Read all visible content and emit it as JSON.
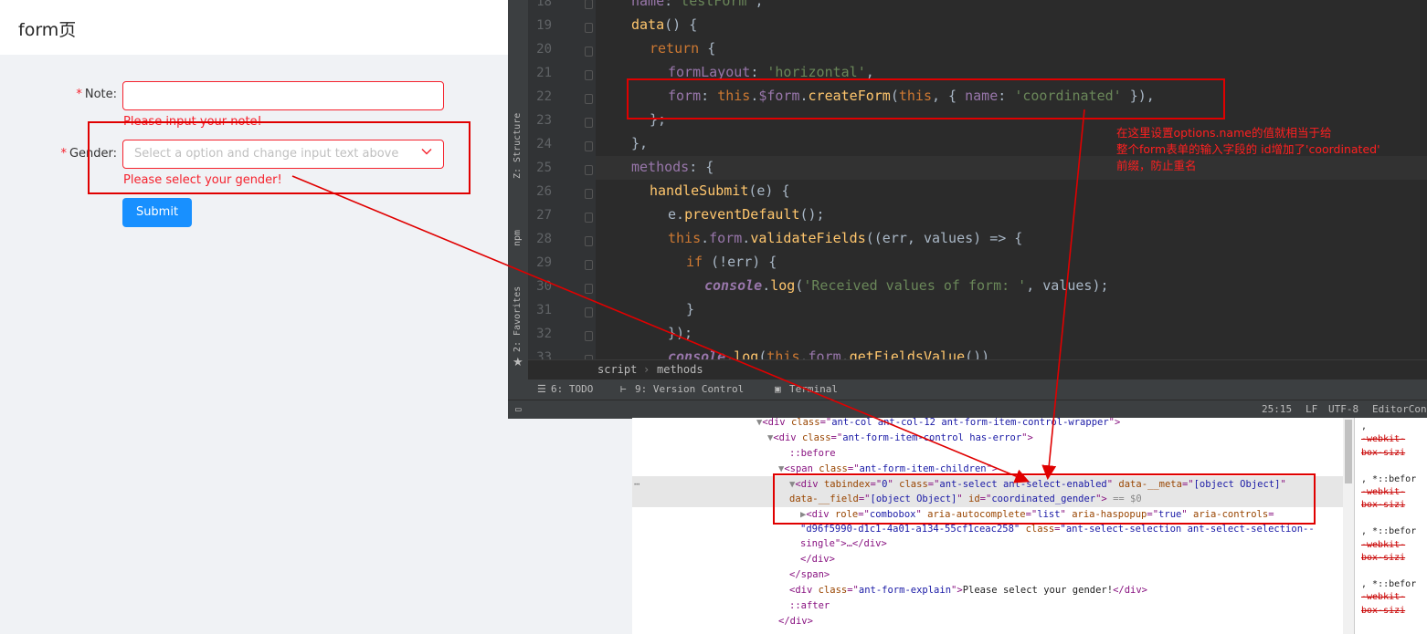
{
  "form_page": {
    "title": "form页",
    "note_label": "Note:",
    "note_value": "",
    "note_error": "Please input your note!",
    "gender_label": "Gender:",
    "gender_placeholder": "Select a option and change input text above",
    "gender_error": "Please select your gender!",
    "required_mark": "*",
    "submit_label": "Submit"
  },
  "ide": {
    "lines": [
      {
        "n": "18",
        "indent": 1,
        "tokens": [
          [
            "prop",
            "name"
          ],
          [
            "plain",
            ":"
          ],
          [
            "str",
            "'testForm'"
          ],
          [
            "plain",
            ","
          ]
        ]
      },
      {
        "n": "19",
        "indent": 1,
        "tokens": [
          [
            "fn",
            "data"
          ],
          [
            "plain",
            "() {"
          ]
        ]
      },
      {
        "n": "20",
        "indent": 2,
        "tokens": [
          [
            "kw",
            "return"
          ],
          [
            "plain",
            " {"
          ]
        ]
      },
      {
        "n": "21",
        "indent": 3,
        "tokens": [
          [
            "prop",
            "formLayout"
          ],
          [
            "plain",
            ": "
          ],
          [
            "str",
            "'horizontal'"
          ],
          [
            "plain",
            ","
          ]
        ]
      },
      {
        "n": "22",
        "indent": 3,
        "tokens": [
          [
            "prop",
            "form"
          ],
          [
            "plain",
            ": "
          ],
          [
            "kw",
            "this"
          ],
          [
            "plain",
            "."
          ],
          [
            "prop",
            "$form"
          ],
          [
            "plain",
            "."
          ],
          [
            "fn",
            "createForm"
          ],
          [
            "plain",
            "("
          ],
          [
            "kw",
            "this"
          ],
          [
            "plain",
            ", { "
          ],
          [
            "prop",
            "name"
          ],
          [
            "plain",
            ": "
          ],
          [
            "str",
            "'coordinated'"
          ],
          [
            "plain",
            " }),"
          ]
        ]
      },
      {
        "n": "23",
        "indent": 2,
        "tokens": [
          [
            "plain",
            "};"
          ]
        ]
      },
      {
        "n": "24",
        "indent": 1,
        "tokens": [
          [
            "plain",
            "},"
          ]
        ]
      },
      {
        "n": "25",
        "indent": 1,
        "tokens": [
          [
            "prop",
            "methods"
          ],
          [
            "plain",
            ": {"
          ]
        ]
      },
      {
        "n": "26",
        "indent": 2,
        "tokens": [
          [
            "fn",
            "handleSubmit"
          ],
          [
            "plain",
            "(e) {"
          ]
        ]
      },
      {
        "n": "27",
        "indent": 3,
        "tokens": [
          [
            "plain",
            "e."
          ],
          [
            "fn",
            "preventDefault"
          ],
          [
            "plain",
            "();"
          ]
        ]
      },
      {
        "n": "28",
        "indent": 3,
        "tokens": [
          [
            "kw",
            "this"
          ],
          [
            "plain",
            "."
          ],
          [
            "prop",
            "form"
          ],
          [
            "plain",
            "."
          ],
          [
            "fn",
            "validateFields"
          ],
          [
            "plain",
            "((err, values) => {"
          ]
        ]
      },
      {
        "n": "29",
        "indent": 4,
        "tokens": [
          [
            "kw",
            "if"
          ],
          [
            "plain",
            " (!err) {"
          ]
        ]
      },
      {
        "n": "30",
        "indent": 5,
        "tokens": [
          [
            "cons",
            "console"
          ],
          [
            "plain",
            "."
          ],
          [
            "fn",
            "log"
          ],
          [
            "plain",
            "("
          ],
          [
            "str",
            "'Received values of form: '"
          ],
          [
            "plain",
            ", values);"
          ]
        ]
      },
      {
        "n": "31",
        "indent": 4,
        "tokens": [
          [
            "plain",
            "}"
          ]
        ]
      },
      {
        "n": "32",
        "indent": 3,
        "tokens": [
          [
            "plain",
            "});"
          ]
        ]
      },
      {
        "n": "33",
        "indent": 3,
        "tokens": [
          [
            "cons",
            "console"
          ],
          [
            "plain",
            "."
          ],
          [
            "fn",
            "log"
          ],
          [
            "plain",
            "("
          ],
          [
            "kw",
            "this"
          ],
          [
            "plain",
            "."
          ],
          [
            "prop",
            "form"
          ],
          [
            "plain",
            "."
          ],
          [
            "fn",
            "getFieldsValue"
          ],
          [
            "plain",
            "())"
          ]
        ]
      }
    ],
    "sidebar_structure": "Z: Structure",
    "sidebar_npm": "npm",
    "sidebar_favorites": "2: Favorites",
    "breadcrumb": [
      "script",
      "methods"
    ],
    "tool_todo": "6: TODO",
    "tool_vcs": "9: Version Control",
    "tool_terminal": "Terminal",
    "status_pos": "25:15",
    "status_lf": "LF",
    "status_enc": "UTF-8",
    "status_editor": "EditorCon"
  },
  "annotation": {
    "line1": "在这里设置options.name的值就相当于给",
    "line2": "整个form表单的输入字段的 id增加了'coordinated'",
    "line3": "前缀，防止重名"
  },
  "devtools": {
    "l1_tag": "div",
    "l1_attr": "class",
    "l1_val": "ant-col ant-col-12 ant-form-item-control-wrapper",
    "l2_val": "ant-form-item-control has-error",
    "l3": "::before",
    "l4_val": "ant-form-item-children",
    "l5_tabindex": "0",
    "l5_class": "ant-select ant-select-enabled",
    "l5_meta": "[object Object]",
    "l6_field": "[object Object]",
    "l6_id": "coordinated_gender",
    "l6_eq": "== $0",
    "l7_role": "combobox",
    "l7_autocomplete": "list",
    "l7_haspopup": "true",
    "l8_controls": "d96f5990-d1c1-4a01-a134-55cf1ceac258",
    "l8_class": "ant-select-selection ant-select-selection--",
    "l9": "single\">…</div>",
    "l10": "</div>",
    "l11": "</span>",
    "l12_class": "ant-form-explain",
    "l12_text": "Please select your gender!",
    "l13": "::after",
    "l14": "</div>",
    "styles": [
      "},",
      "-webkit-",
      "box-sizi",
      "}",
      "*, *::befor",
      "-webkit-",
      "box-sizi",
      "}",
      "*, *::befor",
      "-webkit-",
      "box-sizi",
      "}",
      "*, *::befor",
      "-webkit-",
      "box-sizi",
      "}"
    ]
  }
}
